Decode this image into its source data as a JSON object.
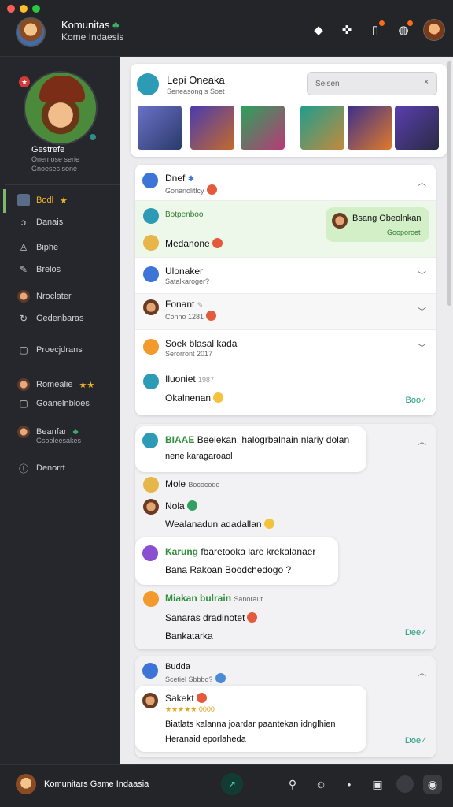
{
  "window": {
    "title": "Komunitas",
    "subtitle": "Kome Indaesis",
    "icons": [
      "bell-icon",
      "puzzle-icon",
      "clipboard-icon",
      "globe-icon",
      "user-avatar"
    ]
  },
  "sidebar": {
    "profile": {
      "name": "Gestrefe",
      "line1": "Onemose serie",
      "line2": "Gnoeses sone"
    },
    "items": [
      {
        "label": "Bodl",
        "sub": "Danais",
        "active": true
      },
      {
        "label": "Biphe",
        "sub": "Brelos"
      },
      {
        "label": "Nroclater",
        "sub": "Gedenbaras"
      },
      {
        "label": "Proecjdrans"
      },
      {
        "label": "Romealie",
        "sub": "Goanelnbloes"
      },
      {
        "label": "Beanfar",
        "sub": "Gsooleesakes"
      },
      {
        "label": "Denorrt"
      }
    ]
  },
  "header_card": {
    "title": "Lepi Oneaka",
    "subtitle": "Seneasong s Soet",
    "search_placeholder": "Seisen",
    "games": [
      "game-thumb-robot",
      "game-thumb-hero",
      "game-thumb-warrior",
      "game-thumb-beast",
      "game-thumb-fox",
      "game-thumb-dragon"
    ]
  },
  "thread1": {
    "title": "Dnef",
    "subtitle": "Gonanolitlcy",
    "rows": [
      {
        "name": "Botpenbool",
        "text": "Medanone"
      },
      {
        "name": "Ulonaker",
        "sub": "Satalkaroger?"
      },
      {
        "name": "Fonant",
        "sub": "Conno 1281"
      },
      {
        "name": "Soek blasal kada",
        "sub": "Serorront 2017"
      },
      {
        "name": "Iluoniet",
        "sub": "1987",
        "text": "Okalnenan"
      }
    ],
    "highlight": {
      "name": "Bsang Obeolnkan",
      "sub": "Gooporoet"
    },
    "more": "Boo"
  },
  "thread2": {
    "messages": [
      {
        "name": "BIAAE",
        "text": "Beelekan, halogrbalnain nlariy dolan",
        "text2": "nene karagaroaol"
      },
      {
        "name": "Mole",
        "sub": "Bococodo"
      },
      {
        "name": "Nola",
        "text": "Wealanadun adadallan"
      },
      {
        "name": "Karung",
        "text": "fbaretooka lare krekalanaer",
        "text2": "Bana Rakoan Boodchedogo ?"
      },
      {
        "name": "Miakan bulrain",
        "sub": "Sanoraut",
        "text": "Sanaras dradinotet",
        "text2": "Bankatarka"
      }
    ],
    "more": "Dee"
  },
  "thread3": {
    "title": "Budda",
    "subtitle": "Scetiel Sbbbo?",
    "reply": {
      "name": "Sakekt",
      "stars": "★★★★★ 0000",
      "text": "Biatlats kalanna joardar paantekan idnglhien",
      "text2": "Heranaid eporlaheda"
    },
    "more": "Doe"
  },
  "bottombar": {
    "title": "Komunitars Game Indaasia"
  }
}
